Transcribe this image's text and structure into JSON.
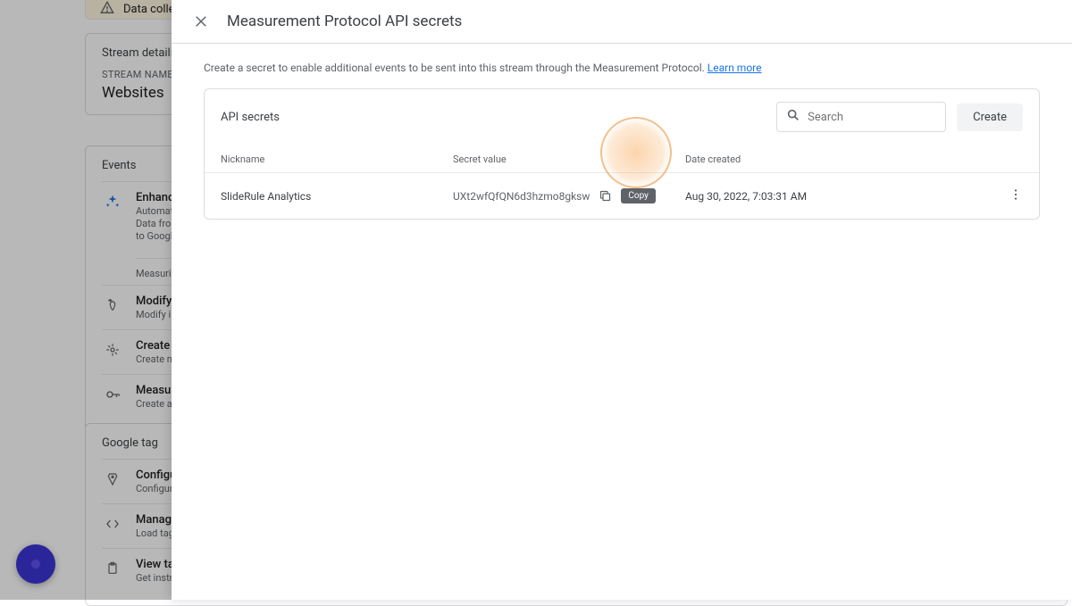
{
  "bg": {
    "warning_text": "Data collect",
    "stream_details_title": "Stream details",
    "stream_name_label": "STREAM NAME",
    "stream_name_value": "Websites",
    "events_title": "Events",
    "enhanced_title": "Enhanced",
    "enhanced_sub1": "Automatically",
    "enhanced_sub2": "Data from on",
    "enhanced_sub3": "to Google. L",
    "measuring_label": "Measuring:",
    "modify_title": "Modify eve",
    "modify_sub": "Modify inco",
    "create_title": "Create cus",
    "create_sub": "Create new",
    "measure_title": "Measurem",
    "measure_sub": "Create an A",
    "google_tag_title": "Google tag",
    "configure_title": "Configure",
    "configure_sub": "Configure yo",
    "manage_title": "Manage co",
    "manage_sub": "Load tags fo",
    "viewtag_title": "View tag i",
    "viewtag_sub": "Get instructi"
  },
  "modal": {
    "title": "Measurement Protocol API secrets",
    "intro_text": "Create a secret to enable additional events to be sent into this stream through the Measurement Protocol.",
    "learn_more": "Learn more",
    "secrets_title": "API secrets",
    "search_placeholder": "Search",
    "create_button": "Create",
    "col_nickname": "Nickname",
    "col_secret": "Secret value",
    "col_date": "Date created",
    "row": {
      "nickname": "SlideRule Analytics",
      "secret": "UXt2wfQfQN6d3hzmo8gksw",
      "date": "Aug 30, 2022, 7:03:31 AM",
      "copy_tooltip": "Copy"
    }
  }
}
